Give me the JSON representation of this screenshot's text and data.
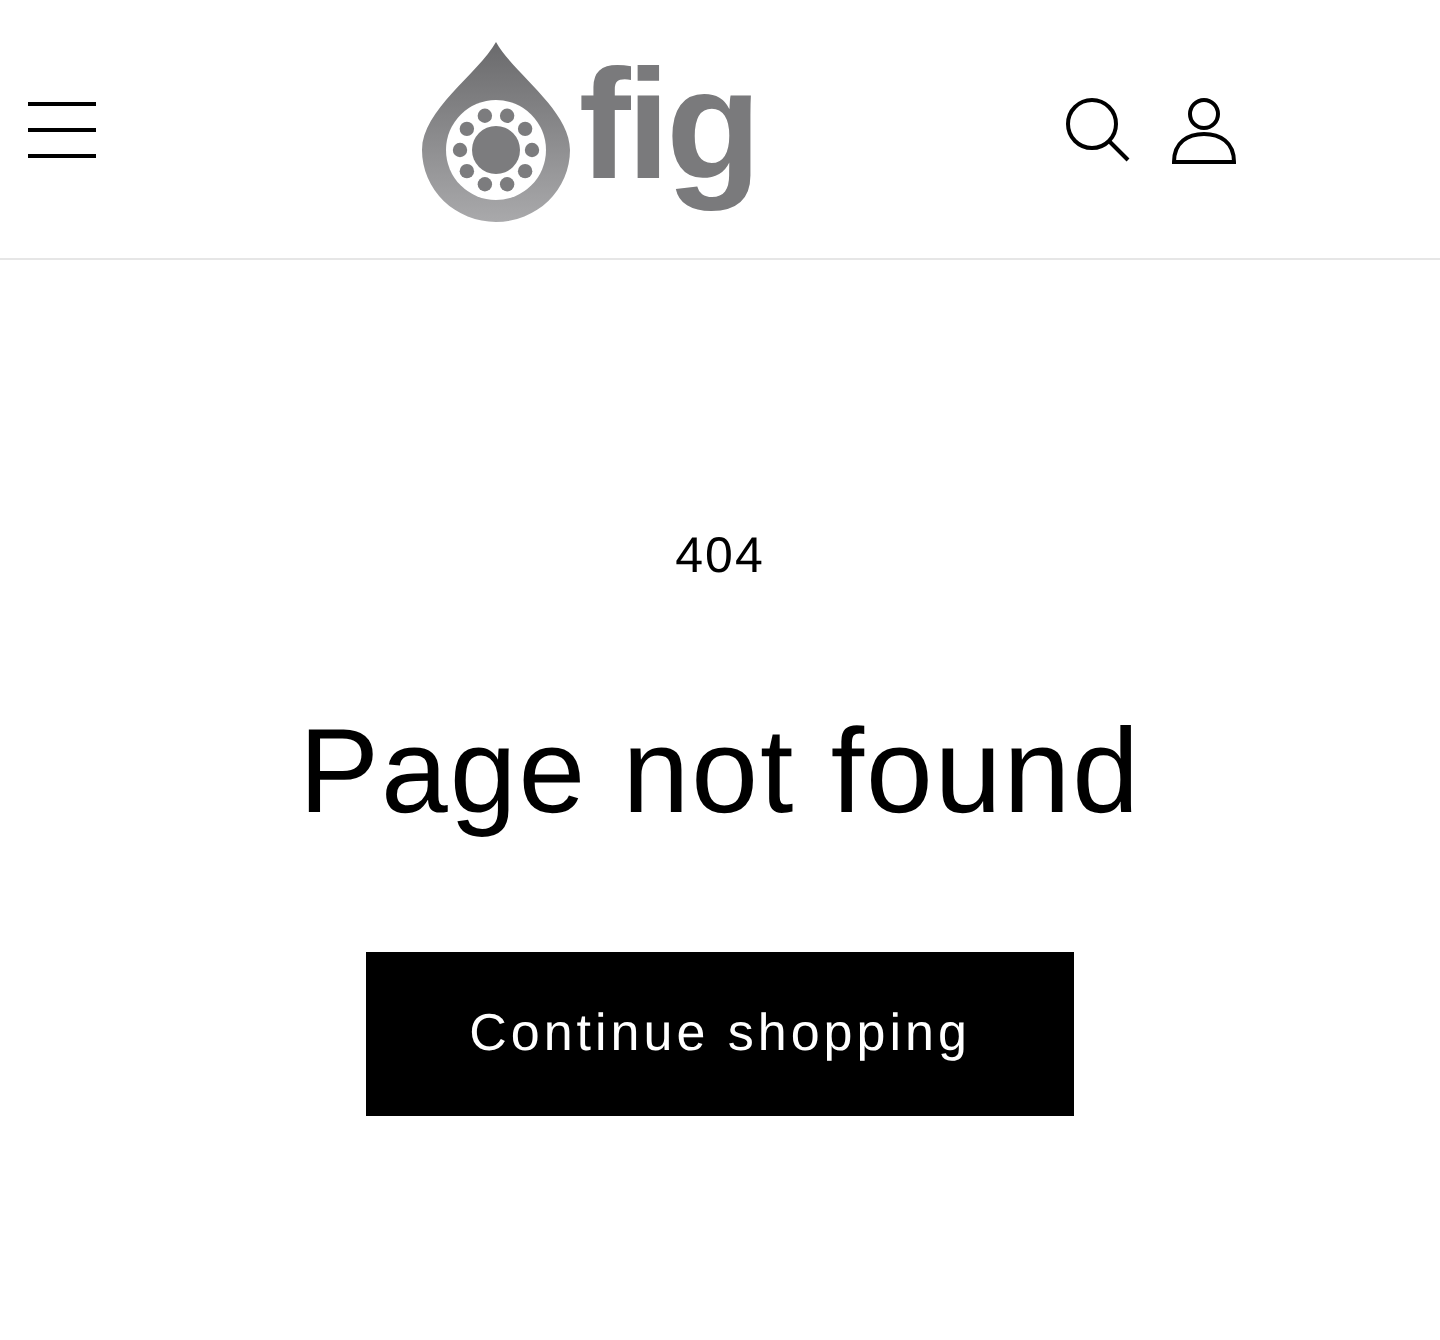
{
  "header": {
    "logo_text": "fig"
  },
  "error": {
    "code": "404",
    "title": "Page not found",
    "button": "Continue shopping"
  }
}
